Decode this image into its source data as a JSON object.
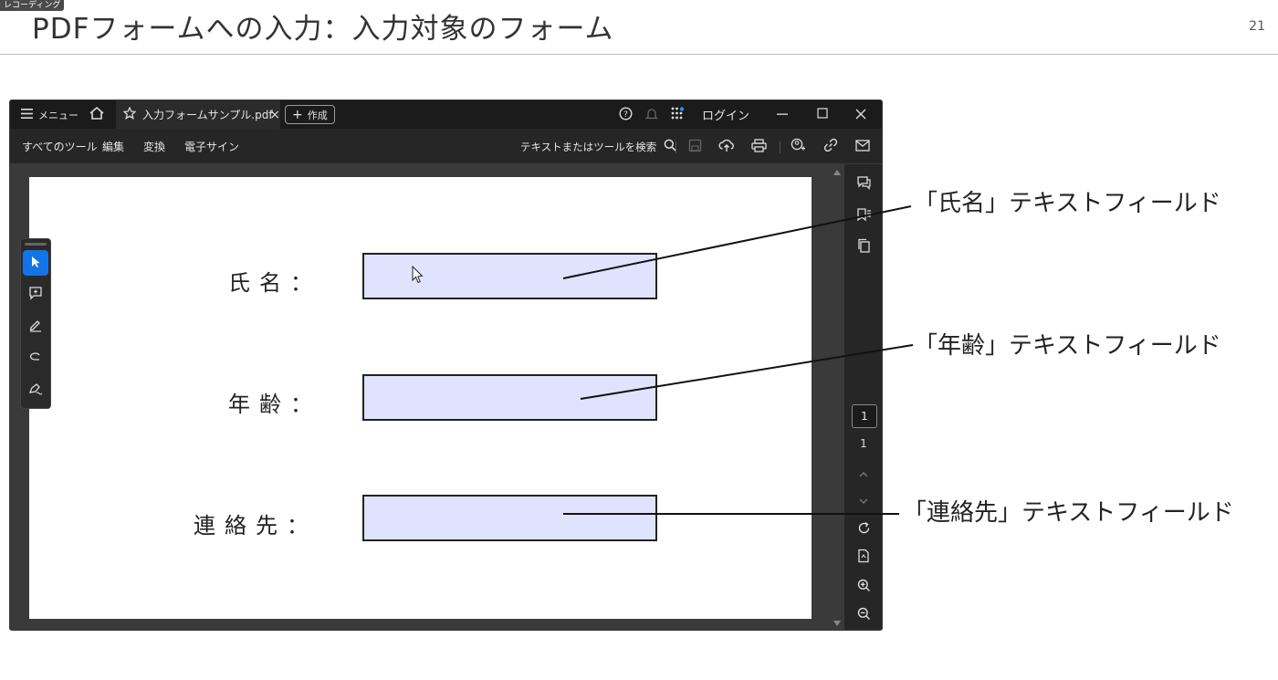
{
  "recording_badge": "レコーディング",
  "slide": {
    "title": "PDFフォームへの入力：入力対象のフォーム",
    "page_number": "21"
  },
  "app": {
    "menu_label": "メニュー",
    "tab_title": "入力フォームサンプル.pdf",
    "tab_close": "×",
    "new_button": "作成",
    "login_label": "ログイン",
    "toolbar": {
      "all_tools": "すべてのツール",
      "edit": "編集",
      "convert": "変換",
      "esign": "電子サイン",
      "search_placeholder": "テキストまたはツールを検索"
    },
    "page_current": "1",
    "page_total": "1",
    "icons": [
      "menu-icon",
      "home-icon",
      "star-icon",
      "plus-icon",
      "help-icon",
      "bell-icon",
      "apps-icon",
      "minimize-icon",
      "maximize-icon",
      "close-icon",
      "search-icon",
      "save-icon",
      "cloud-upload-icon",
      "print-icon",
      "share-icon",
      "link-icon",
      "mail-icon"
    ]
  },
  "form": {
    "name_label": "氏名：",
    "age_label": "年齢：",
    "contact_label": "連絡先："
  },
  "callouts": {
    "name": "「氏名」テキストフィールド",
    "age": "「年齢」テキストフィールド",
    "contact": "「連絡先」テキストフィールド"
  },
  "colors": {
    "field_fill": "#dfe3fd",
    "accent": "#1473e6",
    "app_bg": "#1e1e1e"
  }
}
